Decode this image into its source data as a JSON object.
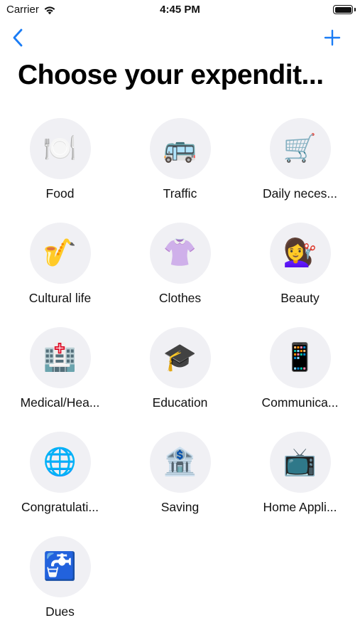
{
  "status_bar": {
    "carrier": "Carrier",
    "time": "4:45 PM"
  },
  "nav": {
    "back_icon": "chevron-left-icon",
    "add_icon": "plus-icon",
    "accent_color": "#1a7cf5"
  },
  "title": "Choose your expendit...",
  "categories": [
    {
      "label": "Food",
      "icon": "fork-knife-plate-icon",
      "glyph": "🍽️"
    },
    {
      "label": "Traffic",
      "icon": "bus-icon",
      "glyph": "🚌"
    },
    {
      "label": "Daily neces...",
      "icon": "shopping-cart-icon",
      "glyph": "🛒"
    },
    {
      "label": "Cultural life",
      "icon": "saxophone-icon",
      "glyph": "🎷"
    },
    {
      "label": "Clothes",
      "icon": "blouse-icon",
      "glyph": "👚"
    },
    {
      "label": "Beauty",
      "icon": "haircut-icon",
      "glyph": "💇‍♀️"
    },
    {
      "label": "Medical/Hea...",
      "icon": "hospital-icon",
      "glyph": "🏥"
    },
    {
      "label": "Education",
      "icon": "graduation-cap-icon",
      "glyph": "🎓"
    },
    {
      "label": "Communica...",
      "icon": "mobile-phone-icon",
      "glyph": "📱"
    },
    {
      "label": "Congratulati...",
      "icon": "globe-hand-icon",
      "glyph": "🌐"
    },
    {
      "label": "Saving",
      "icon": "bank-icon",
      "glyph": "🏦"
    },
    {
      "label": "Home Appli...",
      "icon": "television-icon",
      "glyph": "📺"
    },
    {
      "label": "Dues",
      "icon": "water-tap-icon",
      "glyph": "🚰"
    }
  ]
}
